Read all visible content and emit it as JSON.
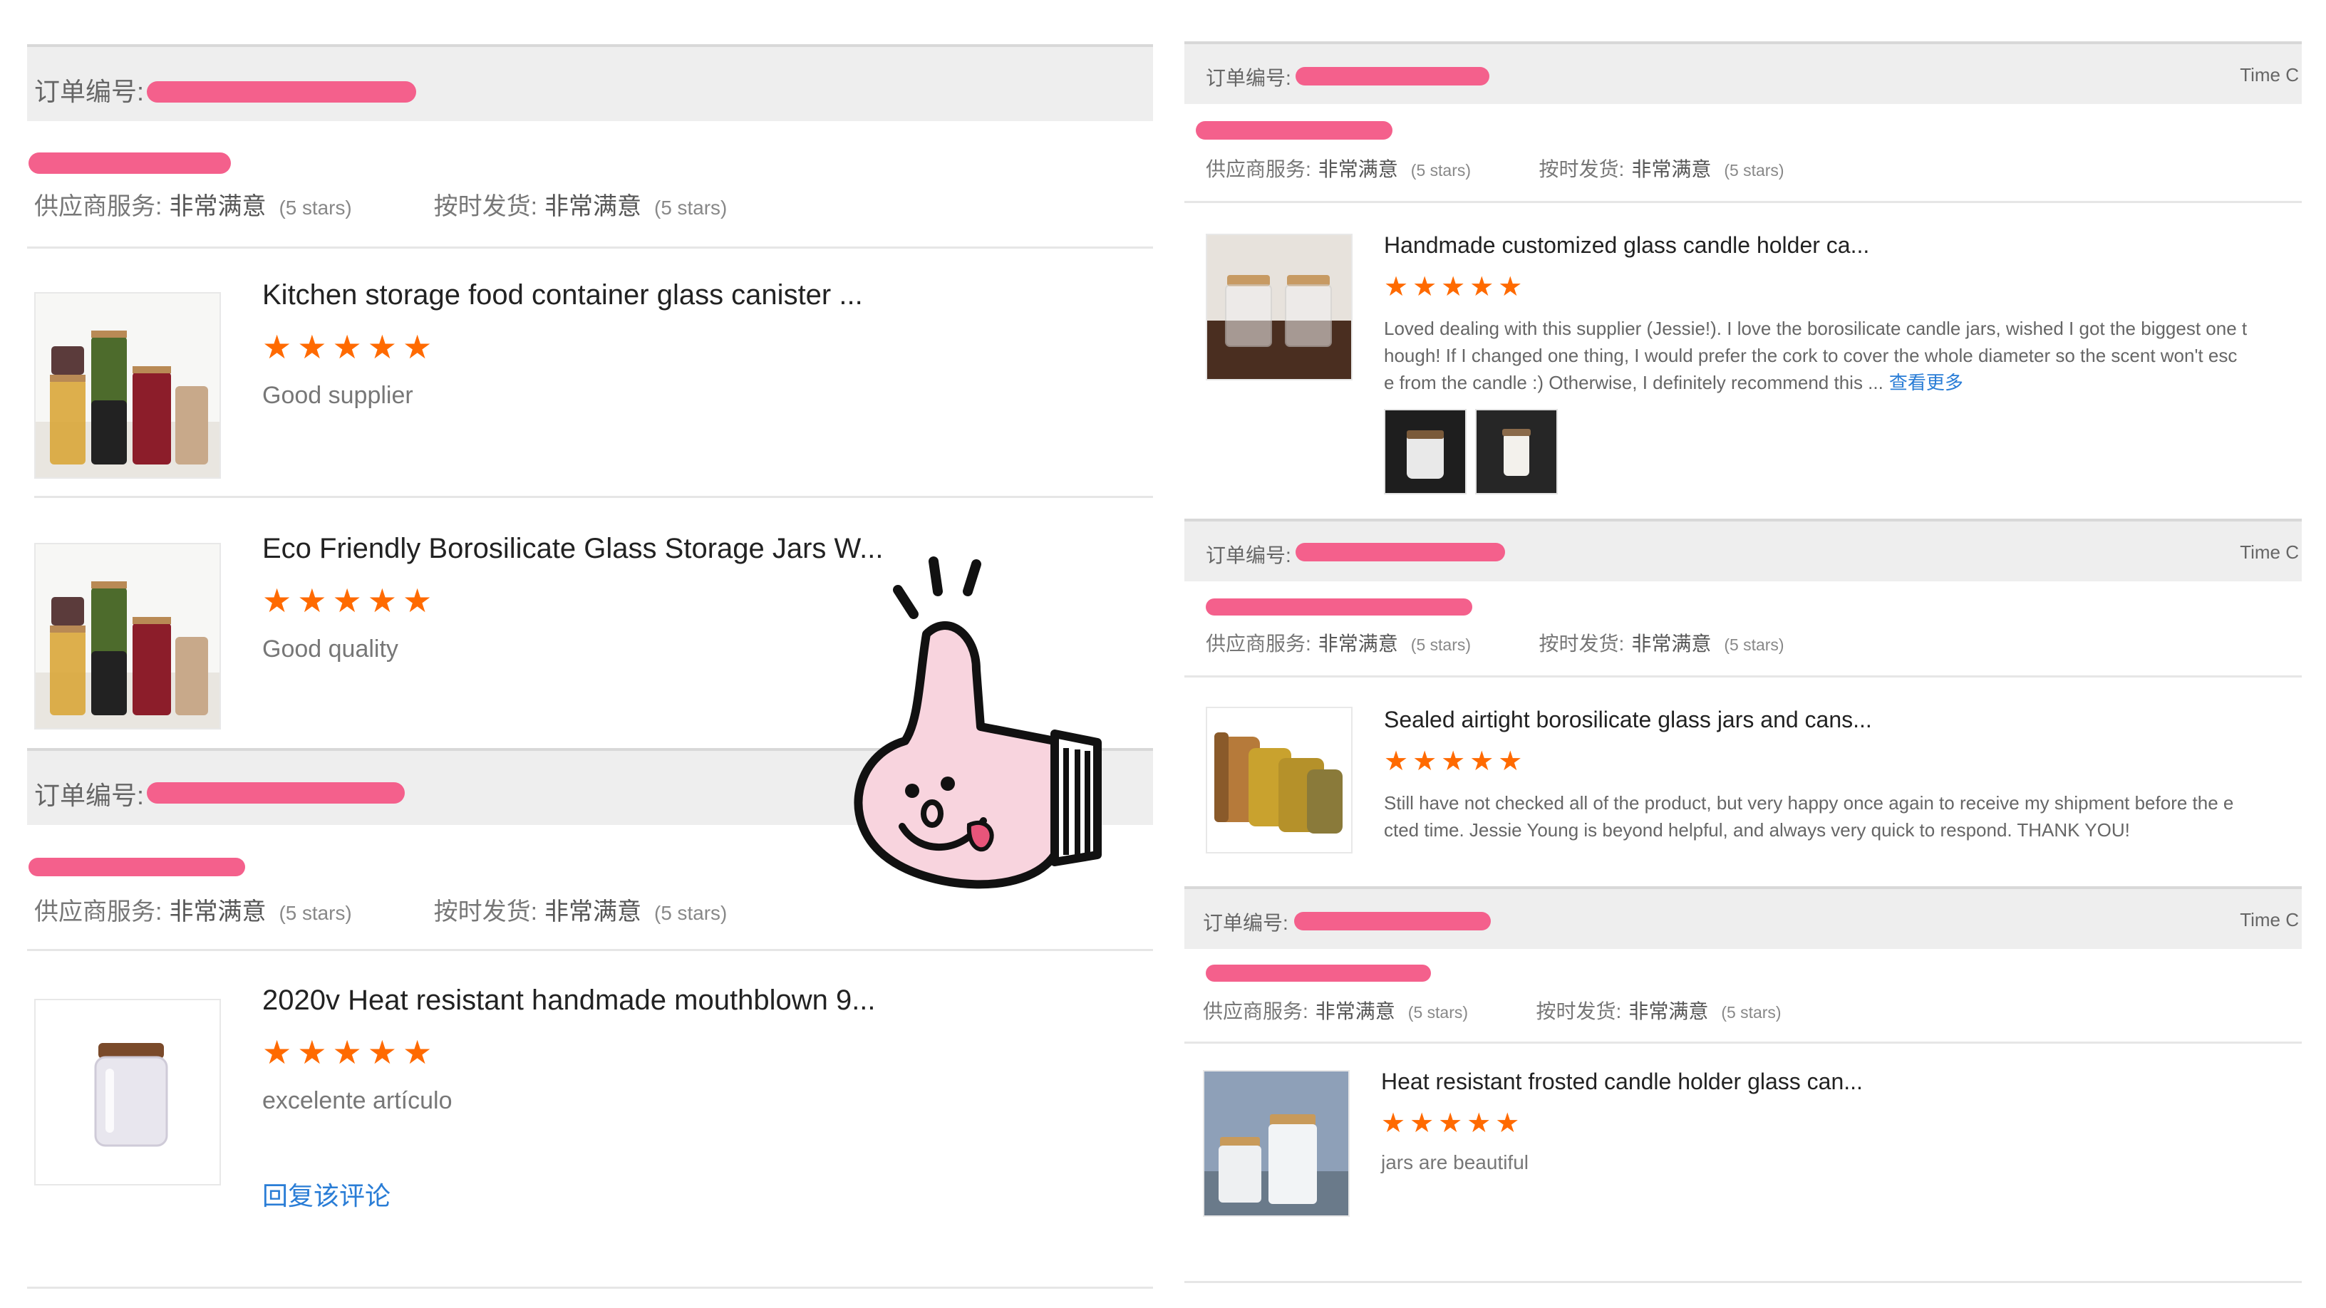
{
  "colors": {
    "star": "#ff6a00",
    "link": "#2a7dd6",
    "redaction": "#f4608c",
    "header_bg": "#eeeeee"
  },
  "left": {
    "orders": [
      {
        "order_label": "订单编号:",
        "supplier_service_label": "供应商服务:",
        "supplier_service_value": "非常满意",
        "supplier_service_stars": "(5 stars)",
        "on_time_label": "按时发货:",
        "on_time_value": "非常满意",
        "on_time_stars": "(5 stars)",
        "items": [
          {
            "title": "Kitchen storage food container glass canister ...",
            "stars": "★★★★★",
            "review": "Good supplier",
            "thumb_icon": "glass-jars-icon"
          },
          {
            "title": "Eco Friendly Borosilicate Glass Storage Jars W...",
            "stars": "★★★★★",
            "review": "Good quality",
            "thumb_icon": "glass-jars-icon"
          }
        ]
      },
      {
        "order_label": "订单编号:",
        "supplier_service_label": "供应商服务:",
        "supplier_service_value": "非常满意",
        "supplier_service_stars": "(5 stars)",
        "on_time_label": "按时发货:",
        "on_time_value": "非常满意",
        "on_time_stars": "(5 stars)",
        "items": [
          {
            "title": "2020v Heat resistant handmade mouthblown 9...",
            "stars": "★★★★★",
            "review": "excelente artículo",
            "reply": "回复该评论",
            "thumb_icon": "frosted-jar-icon"
          }
        ]
      }
    ]
  },
  "right": {
    "orders": [
      {
        "order_label": "订单编号:",
        "time_label": "Time C",
        "supplier_service_label": "供应商服务:",
        "supplier_service_value": "非常满意",
        "supplier_service_stars": "(5 stars)",
        "on_time_label": "按时发货:",
        "on_time_value": "非常满意",
        "on_time_stars": "(5 stars)",
        "item": {
          "title": "Handmade customized glass candle holder ca...",
          "stars": "★★★★★",
          "review_lines": [
            "Loved dealing with this supplier (Jessie!). I love the borosilicate candle jars, wished I got the biggest one t",
            "hough! If I changed one thing, I would prefer the cork to cover the whole diameter so the scent won't esc",
            "e from the candle :) Otherwise, I definitely recommend this ..."
          ],
          "more_link": "查看更多",
          "thumb_icon": "candle-jars-icon",
          "photo_icons": [
            "candle-photo-icon",
            "candle-photo-icon"
          ]
        }
      },
      {
        "order_label": "订单编号:",
        "time_label": "Time C",
        "supplier_service_label": "供应商服务:",
        "supplier_service_value": "非常满意",
        "supplier_service_stars": "(5 stars)",
        "on_time_label": "按时发货:",
        "on_time_value": "非常满意",
        "on_time_stars": "(5 stars)",
        "item": {
          "title": "Sealed airtight borosilicate glass jars and cans...",
          "stars": "★★★★★",
          "review_lines": [
            "Still have not checked all of the product, but very happy once again to receive my shipment before the e",
            "cted time. Jessie Young is beyond helpful, and always very quick to respond. THANK YOU!"
          ],
          "thumb_icon": "spice-jars-icon"
        }
      },
      {
        "order_label": "订单编号:",
        "time_label": "Time C",
        "supplier_service_label": "供应商服务:",
        "supplier_service_value": "非常满意",
        "supplier_service_stars": "(5 stars)",
        "on_time_label": "按时发货:",
        "on_time_value": "非常满意",
        "on_time_stars": "(5 stars)",
        "item": {
          "title": "Heat resistant frosted candle holder glass can...",
          "stars": "★★★★★",
          "review": "jars are beautiful",
          "thumb_icon": "frosted-candle-jars-icon"
        }
      }
    ]
  },
  "sticker_icon": "thumbs-up-sticker-icon"
}
